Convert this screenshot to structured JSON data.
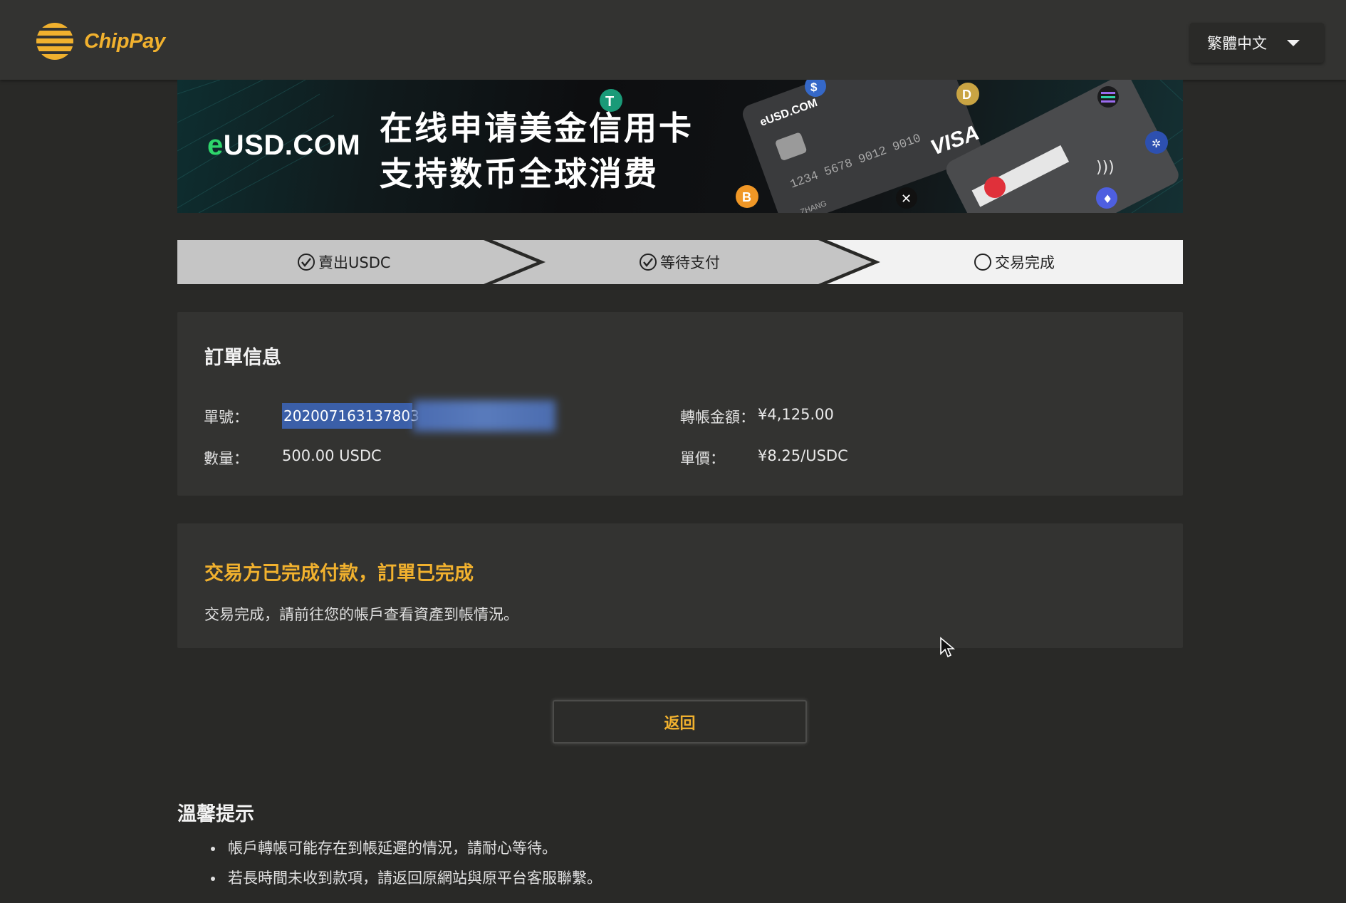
{
  "header": {
    "logo_text": "ChipPay",
    "language": "繁體中文"
  },
  "banner": {
    "brand_prefix": "e",
    "brand_rest": "USD.COM",
    "line1": "在线申请美金信用卡",
    "line2": "支持数币全球消费",
    "card_brand": "VISA",
    "card_number": "1234 5678 9012 9010",
    "card_text": "eUSD.COM",
    "card_holder": "ZHANG"
  },
  "steps": [
    {
      "label": "賣出USDC",
      "state": "done"
    },
    {
      "label": "等待支付",
      "state": "done"
    },
    {
      "label": "交易完成",
      "state": "current"
    }
  ],
  "order": {
    "title": "訂單信息",
    "order_no_label": "單號：",
    "order_no_value": "202007163137803",
    "amount_label": "轉帳金額：",
    "amount_value": "¥4,125.00",
    "qty_label": "數量：",
    "qty_value": "500.00 USDC",
    "price_label": "單價：",
    "price_value": "¥8.25/USDC"
  },
  "status": {
    "title": "交易方已完成付款，訂單已完成",
    "desc": "交易完成，請前往您的帳戶查看資產到帳情況。"
  },
  "back_button": "返回",
  "tips": {
    "title": "溫馨提示",
    "items": [
      "帳戶轉帳可能存在到帳延遲的情況，請耐心等待。",
      "若長時間未收到款項，請返回原網站與原平台客服聯繫。"
    ]
  },
  "colors": {
    "accent": "#f1b12e",
    "background": "#292927",
    "card": "#333331",
    "step_done": "#c7c7c7",
    "step_current": "#f2f2f2"
  }
}
